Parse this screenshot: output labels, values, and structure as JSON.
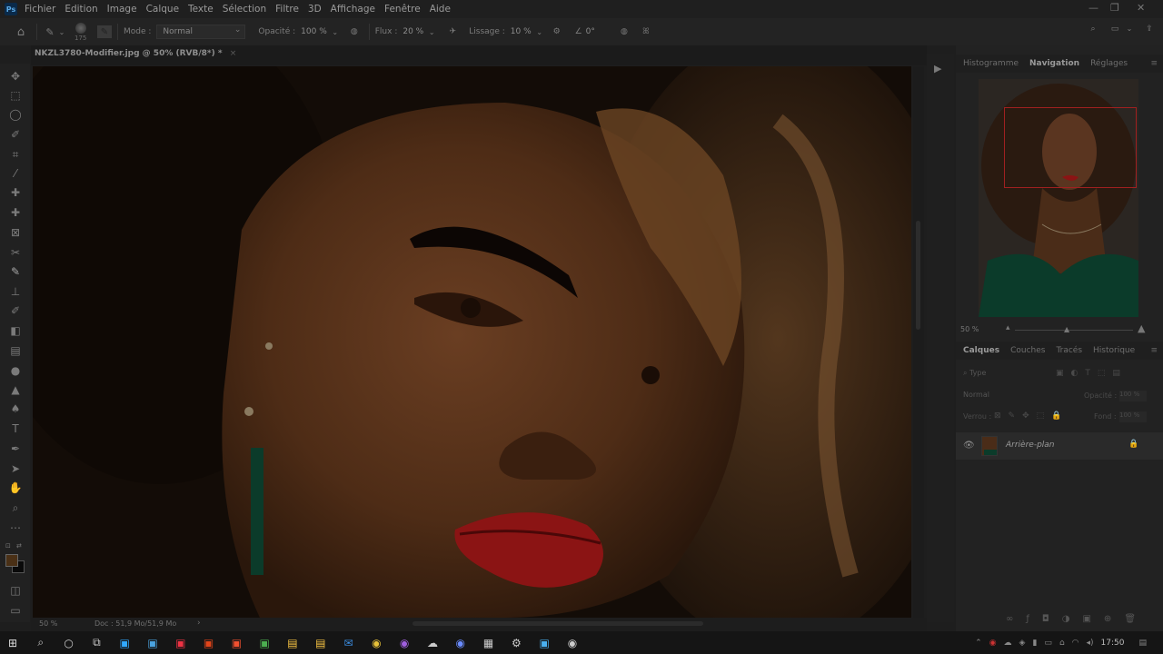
{
  "app": {
    "logo": "Ps"
  },
  "menu": [
    "Fichier",
    "Edition",
    "Image",
    "Calque",
    "Texte",
    "Sélection",
    "Filtre",
    "3D",
    "Affichage",
    "Fenêtre",
    "Aide"
  ],
  "options": {
    "brush_size": "175",
    "mode_label": "Mode :",
    "mode_value": "Normal",
    "opacity_label": "Opacité :",
    "opacity_value": "100 %",
    "flow_label": "Flux :",
    "flow_value": "20 %",
    "smoothing_label": "Lissage :",
    "smoothing_value": "10 %",
    "angle_value": "0°"
  },
  "document": {
    "tab_title": "NKZL3780-Modifier.jpg @ 50% (RVB/8*) *",
    "close": "×"
  },
  "status": {
    "zoom": "50 %",
    "doc_info": "Doc : 51,9 Mo/51,9 Mo"
  },
  "top_panel": {
    "tabs": [
      "Histogramme",
      "Navigation",
      "Réglages"
    ],
    "active_tab": "Navigation",
    "zoom": "50 %"
  },
  "layers_panel": {
    "tabs": [
      "Calques",
      "Couches",
      "Tracés",
      "Historique"
    ],
    "active_tab": "Calques",
    "search_placeholder": "Type",
    "blend_mode": "Normal",
    "opacity_label": "Opacité :",
    "opacity_value": "100 %",
    "lock_label": "Verrou :",
    "fill_label": "Fond :",
    "fill_value": "100 %",
    "layers": [
      {
        "name": "Arrière-plan",
        "visible": true,
        "locked": true
      }
    ]
  },
  "taskbar": {
    "time": "17:50"
  },
  "colors": {
    "accent": "#0a2a4a",
    "nav_box": "#a02020",
    "lips": "#8b1414",
    "dress": "#0b3b2a"
  }
}
